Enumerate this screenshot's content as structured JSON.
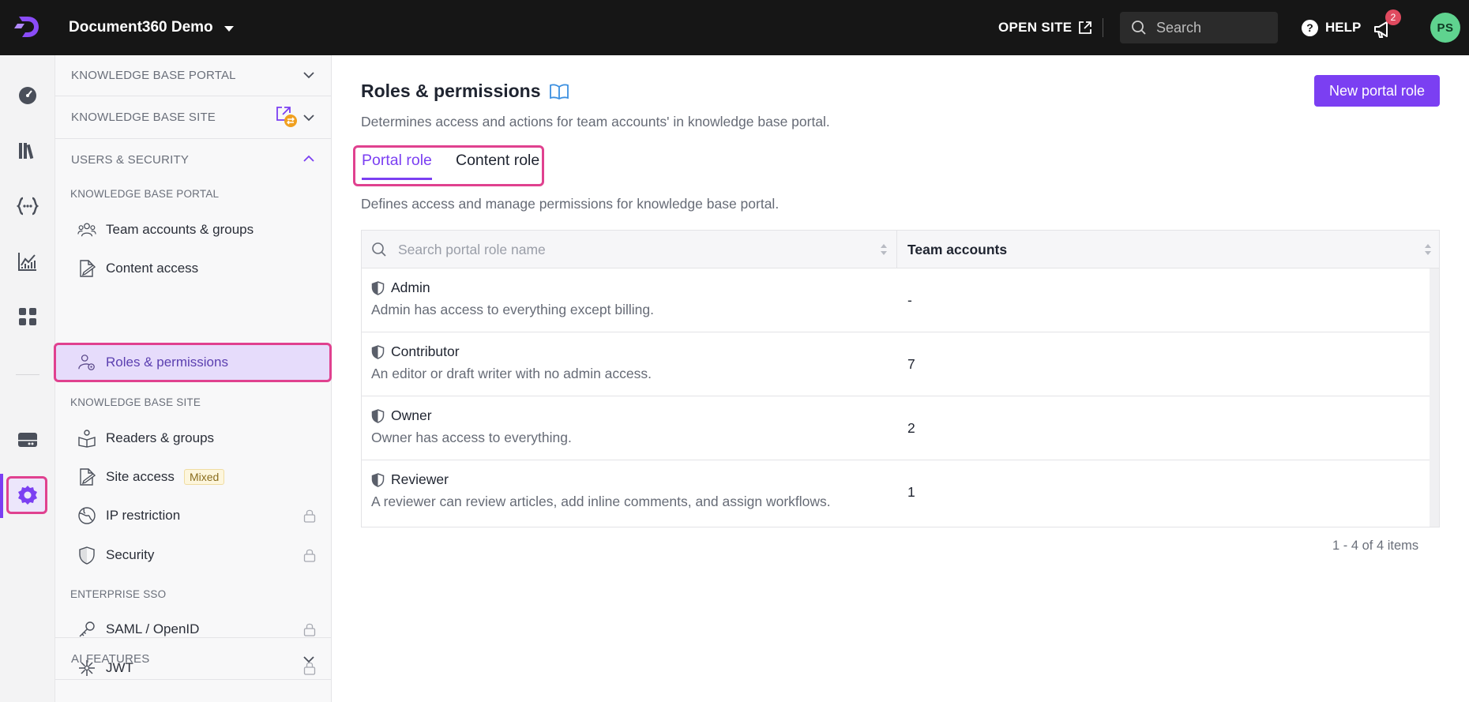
{
  "topbar": {
    "project_name": "Document360 Demo",
    "open_site": "OPEN SITE",
    "search_placeholder": "Search",
    "help": "HELP",
    "notification_count": "2",
    "avatar_initials": "PS"
  },
  "panel": {
    "sections": {
      "kb_portal": "KNOWLEDGE BASE PORTAL",
      "kb_site": "KNOWLEDGE BASE SITE",
      "users_security": "USERS & SECURITY",
      "ai_features": "AI FEATURES"
    },
    "subheads": {
      "kb_portal": "KNOWLEDGE BASE PORTAL",
      "kb_site": "KNOWLEDGE BASE SITE",
      "enterprise_sso": "ENTERPRISE SSO"
    },
    "items": {
      "team_accounts": "Team accounts & groups",
      "content_access": "Content access",
      "roles_permissions": "Roles & permissions",
      "readers_groups": "Readers & groups",
      "site_access": "Site access",
      "site_access_badge": "Mixed",
      "ip_restriction": "IP restriction",
      "security": "Security",
      "saml": "SAML / OpenID",
      "jwt": "JWT"
    }
  },
  "main": {
    "title": "Roles & permissions",
    "description": "Determines access and actions for team accounts' in knowledge base portal.",
    "new_button": "New portal role",
    "tabs": {
      "portal": "Portal role",
      "content": "Content role"
    },
    "sub_description": "Defines access and manage permissions for knowledge base portal.",
    "table": {
      "search_placeholder": "Search portal role name",
      "col_team": "Team accounts",
      "rows": [
        {
          "name": "Admin",
          "desc": "Admin has access to everything except billing.",
          "count": "-"
        },
        {
          "name": "Contributor",
          "desc": "An editor or draft writer with no admin access.",
          "count": "7"
        },
        {
          "name": "Owner",
          "desc": "Owner has access to everything.",
          "count": "2"
        },
        {
          "name": "Reviewer",
          "desc": "A reviewer can review articles, add inline comments, and assign workflows.",
          "count": "1"
        }
      ]
    },
    "pager": "1 - 4 of 4 items"
  },
  "colors": {
    "accent": "#7b3ff2",
    "highlight": "#e0418f",
    "topbar": "#161616"
  }
}
